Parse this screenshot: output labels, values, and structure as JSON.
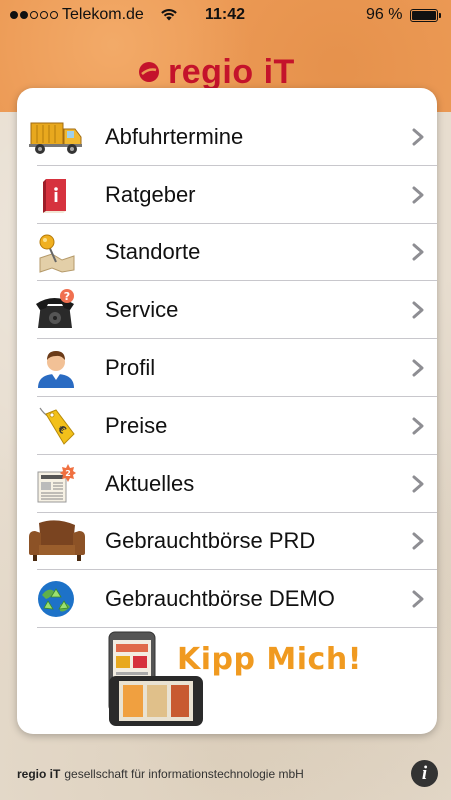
{
  "status_bar": {
    "carrier": "Telekom.de",
    "time": "11:42",
    "battery": "96 %",
    "battery_level": 0.96,
    "signal_bars": 2
  },
  "header": {
    "logo_text": "regio iT",
    "brand_color": "#c4132b",
    "band_color": "#ec9a55"
  },
  "menu": {
    "items": [
      {
        "label": "Abfuhrtermine",
        "icon": "garbage-truck-icon"
      },
      {
        "label": "Ratgeber",
        "icon": "book-icon"
      },
      {
        "label": "Standorte",
        "icon": "map-pin-icon"
      },
      {
        "label": "Service",
        "icon": "telephone-icon"
      },
      {
        "label": "Profil",
        "icon": "user-icon"
      },
      {
        "label": "Preise",
        "icon": "price-tag-icon"
      },
      {
        "label": "Aktuelles",
        "icon": "newspaper-icon"
      },
      {
        "label": "Gebrauchtbörse PRD",
        "icon": "armchair-icon"
      },
      {
        "label": "Gebrauchtbörse DEMO",
        "icon": "recycle-globe-icon"
      }
    ]
  },
  "promo": {
    "text": "Kipp Mich!",
    "accent": "#f09a20"
  },
  "footer": {
    "brand": "regio iT",
    "company": "gesellschaft für informationstechnologie mbH",
    "info_symbol": "i"
  }
}
